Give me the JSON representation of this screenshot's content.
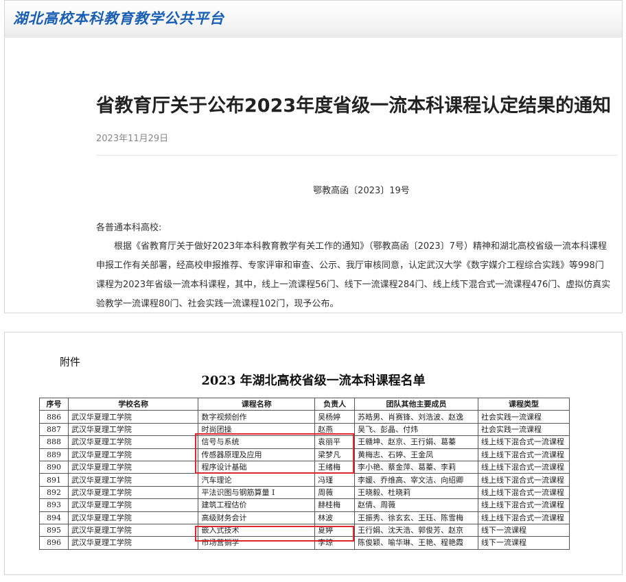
{
  "site": {
    "title": "湖北高校本科教育教学公共平台"
  },
  "article": {
    "title": "省教育厅关于公布2023年度省级一流本科课程认定结果的通知",
    "date": "2023年11月29日",
    "doc_number": "鄂教高函〔2023〕19号",
    "salutation": "各普通本科高校:",
    "body": "根据《省教育厅关于做好2023年本科教育教学有关工作的通知》（鄂教高函〔2023〕7号）精神和湖北高校省级一流本科课程申报工作有关部署，经高校申报推荐、专家评审和审查、公示、我厅审核同意，认定武汉大学《数字媒介工程综合实践》等998门课程为2023年省级一流本科课程，其中，线上一流课程56门、线下一流课程284门、线上线下混合式一流课程476门、虚拟仿真实验教学一流课程80门、社会实践一流课程102门，现予公布。"
  },
  "attachment": {
    "label": "附件",
    "list_title": "2023 年湖北高校省级一流本科课程名单",
    "headers": [
      "序号",
      "学校名称",
      "课程名称",
      "负责人",
      "团队其他主要成员",
      "课程类型"
    ],
    "rows": [
      [
        "886",
        "武汉华夏理工学院",
        "数字视频创作",
        "吴杨婷",
        "苏皓男、肖赛锋、刘浩波、赵逸",
        "社会实践一流课程"
      ],
      [
        "887",
        "武汉华夏理工学院",
        "时尚团操",
        "赵燕",
        "吴飞、彭晶、付炜",
        "社会实践一流课程"
      ],
      [
        "888",
        "武汉华夏理工学院",
        "信号与系统",
        "袁丽平",
        "王赣坤、赵京、王行娟、葛蓁",
        "线上线下混合式一流课程"
      ],
      [
        "889",
        "武汉华夏理工学院",
        "传感器原理及应用",
        "梁梦凡",
        "黄梅志、石婷、王金凤",
        "线上线下混合式一流课程"
      ],
      [
        "890",
        "武汉华夏理工学院",
        "程序设计基础",
        "王绪梅",
        "李小艳、蔡金萍、葛蓁、李莉",
        "线上线下混合式一流课程"
      ],
      [
        "891",
        "武汉华夏理工学院",
        "汽车理论",
        "冯瑾",
        "李媛、乔维高、宰文洁、向绍卿",
        "线上线下混合式一流课程"
      ],
      [
        "892",
        "武汉华夏理工学院",
        "平法识图与钢筋算量 I",
        "周薇",
        "王晓毅、杜晓莉",
        "线上线下混合式一流课程"
      ],
      [
        "893",
        "武汉华夏理工学院",
        "建筑工程估价",
        "赫桂梅",
        "赵倩、周薇",
        "线上线下混合式一流课程"
      ],
      [
        "894",
        "武汉华夏理工学院",
        "高级财务会计",
        "林波",
        "王振秀、徐玄玄、王珏、陈雪梅",
        "线上线下混合式一流课程"
      ],
      [
        "895",
        "武汉华夏理工学院",
        "嵌入式技术",
        "夏婷",
        "王行娟、沈天浩、郭俊芳、赵京",
        "线下一流课程"
      ],
      [
        "896",
        "武汉华夏理工学院",
        "市场营销学",
        "李琼",
        "陈俊颖、喻华琳、王艳、程艳霞",
        "线下一流课程"
      ]
    ]
  },
  "colors": {
    "brand": "#1a5fb4",
    "highlight": "#e0262b"
  }
}
